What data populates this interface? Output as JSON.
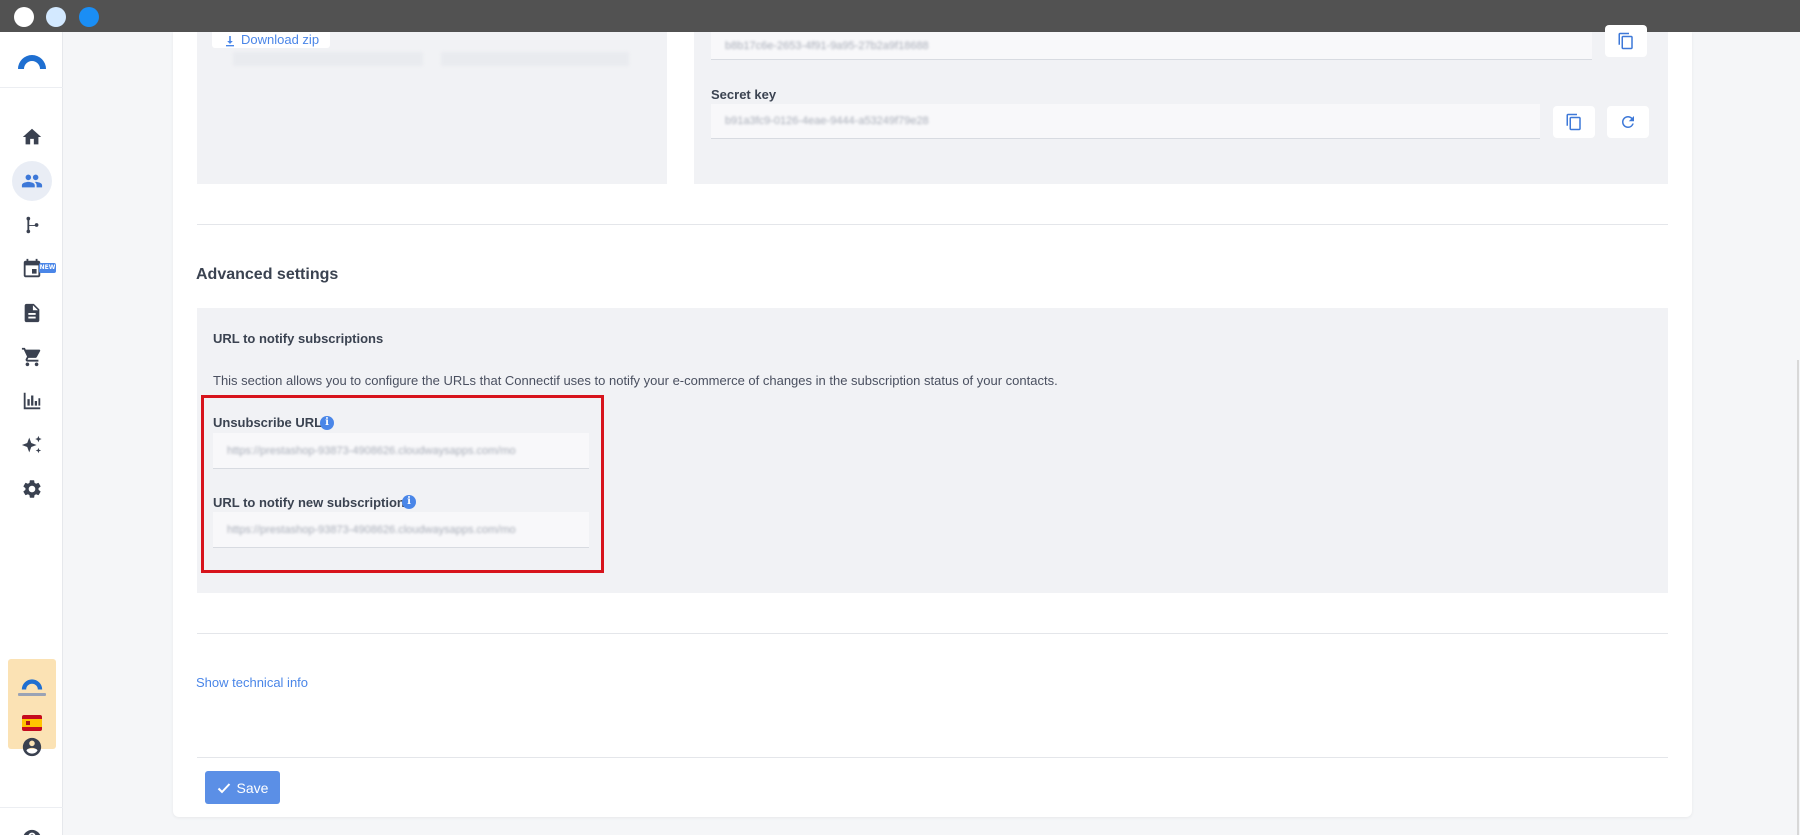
{
  "window": {
    "controls": [
      "close",
      "minimize",
      "maximize"
    ]
  },
  "sidebar": {
    "logo": "connectif-logo",
    "items": [
      {
        "icon": "home-icon",
        "active": false
      },
      {
        "icon": "contacts-icon",
        "active": true
      },
      {
        "icon": "workflow-icon",
        "active": false
      },
      {
        "icon": "calendar-icon",
        "active": false,
        "badge": "NEW"
      },
      {
        "icon": "document-icon",
        "active": false
      },
      {
        "icon": "cart-icon",
        "active": false
      },
      {
        "icon": "chart-icon",
        "active": false
      },
      {
        "icon": "sparkles-icon",
        "active": false
      },
      {
        "icon": "gear-icon",
        "active": false
      }
    ],
    "account": {
      "flag": "es-flag"
    },
    "bottom_icons": [
      "user-icon",
      "help-icon"
    ]
  },
  "top_section": {
    "download_label": "Download zip",
    "client_id_value": "b8b17c6e-2653-4f91-9a95-27b2a9f18688",
    "secret_key_label": "Secret key",
    "secret_key_value": "b91a3fc9-0126-4eae-9444-a53249f79e28"
  },
  "advanced": {
    "title": "Advanced settings",
    "subtitle": "URL to notify subscriptions",
    "description": "This section allows you to configure the URLs that Connectif uses to notify your e-commerce of changes in the subscription status of your contacts.",
    "unsubscribe_label": "Unsubscribe URL",
    "unsubscribe_value": "https://prestashop-93873-4908626.cloudwaysapps.com/mo",
    "new_sub_label": "URL to notify new subscription",
    "new_sub_value": "https://prestashop-93873-4908626.cloudwaysapps.com/mo"
  },
  "footer": {
    "tech_info_link": "Show technical info",
    "save_label": "Save"
  },
  "colors": {
    "accent": "#4a86e8",
    "highlight_border": "#d7141c",
    "panel_bg": "#f1f2f5"
  }
}
